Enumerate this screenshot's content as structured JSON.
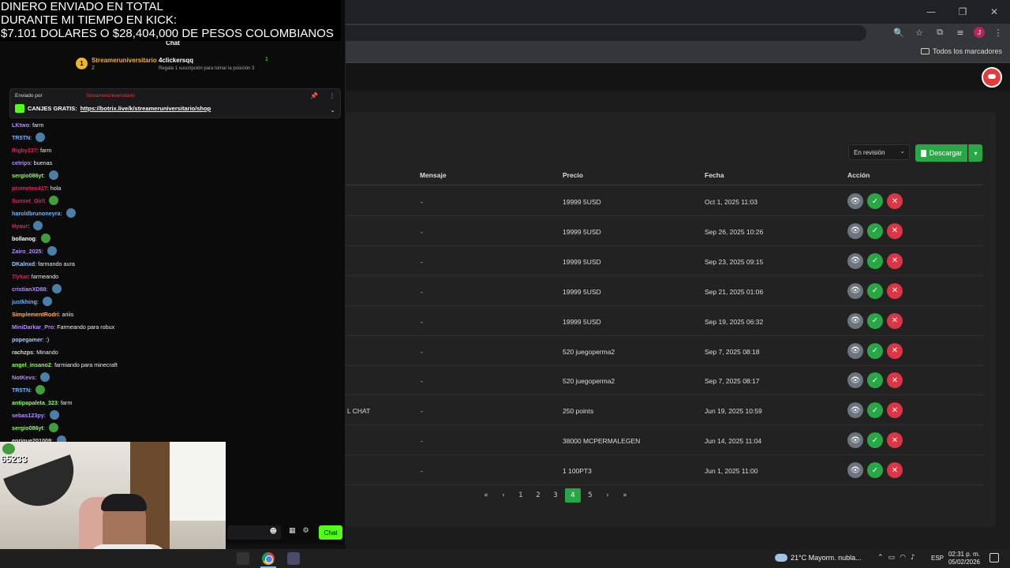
{
  "overlay": {
    "line1": "DINERO ENVIADO EN TOTAL",
    "line2": "DURANTE MI TIEMPO EN KICK:",
    "line3": "$7.101 DOLARES O $28,404,000 DE PESOS COLOMBIANOS"
  },
  "chat": {
    "title": "Chat",
    "top_gifters": [
      {
        "rank": "1",
        "name": "Streameruniversitario",
        "count": "2"
      },
      {
        "name": "4clickersqq",
        "count": "1",
        "subtext": "Regala 1 suscripción para tomar la posición 3"
      }
    ],
    "pinned": {
      "by_label": "Enviado por",
      "by_name": "Streameruniversitario",
      "message_prefix": "CANJES GRATIS:",
      "link": "https://botrix.live/k/streameruniversitario/shop"
    },
    "messages": [
      {
        "user": "LKtwo",
        "color": "#b18cff",
        "text": "farm",
        "emote": false
      },
      {
        "user": "TR5TN",
        "color": "#6fb4ff",
        "text": "",
        "emote": true
      },
      {
        "user": "Rigby237",
        "color": "#e0245e",
        "text": "farm",
        "emote": false
      },
      {
        "user": "cetrips",
        "color": "#b18cff",
        "text": "buenas",
        "emote": false
      },
      {
        "user": "sergio086yt",
        "color": "#8cff5a",
        "text": "",
        "emote": true
      },
      {
        "user": "prometeo417",
        "color": "#e0245e",
        "text": "hola",
        "emote": false
      },
      {
        "user": "Sunset_Girl",
        "color": "#e0245e",
        "text": "",
        "emote": true
      },
      {
        "user": "haroldbrunoneyra",
        "color": "#6fb4ff",
        "text": "",
        "emote": true
      },
      {
        "user": "Hyaur",
        "color": "#e0245e",
        "text": "",
        "emote": true
      },
      {
        "user": "bollanog",
        "color": "#ffffff",
        "text": "",
        "emote": true
      },
      {
        "user": "Zairo_2025",
        "color": "#b18cff",
        "text": "",
        "emote": true
      },
      {
        "user": "DKalnxd",
        "color": "#9ad0ff",
        "text": "farmando aura",
        "emote": false
      },
      {
        "user": "7lykar",
        "color": "#e0245e",
        "text": "farmeando",
        "emote": false
      },
      {
        "user": "cristianXD88",
        "color": "#b18cff",
        "text": "",
        "emote": true
      },
      {
        "user": "justkhing",
        "color": "#6fb4ff",
        "text": "",
        "emote": true
      },
      {
        "user": "SimplementRodri",
        "color": "#ffb14a",
        "text": "ariiis",
        "emote": false
      },
      {
        "user": "MiniDarkar_Pro",
        "color": "#b18cff",
        "text": "Farmeando para robux",
        "emote": false
      },
      {
        "user": "popegamer",
        "color": "#9ad0ff",
        "text": ":)",
        "emote": false
      },
      {
        "user": "rachzps",
        "color": "#dddddd",
        "text": "Minando",
        "emote": false
      },
      {
        "user": "angel_insano2",
        "color": "#8cff5a",
        "text": "farmiando para minecraft",
        "emote": false
      },
      {
        "user": "NotKevs",
        "color": "#b18cff",
        "text": "",
        "emote": true
      },
      {
        "user": "TR5TN",
        "color": "#6fb4ff",
        "text": "",
        "emote": true
      },
      {
        "user": "antipapaleta_323",
        "color": "#8cff5a",
        "text": "farm",
        "emote": false
      },
      {
        "user": "sebas123py",
        "color": "#b18cff",
        "text": "",
        "emote": true
      },
      {
        "user": "sergio086yt",
        "color": "#8cff5a",
        "text": "",
        "emote": true
      },
      {
        "user": "enrique201009",
        "color": "#dddddd",
        "text": "",
        "emote": true
      }
    ],
    "send_label": "Chat",
    "viewers": "65233"
  },
  "browser": {
    "bookmarks_folder": "Todos los marcadores",
    "profile_initial": "J"
  },
  "page": {
    "filter_value": "En revisión",
    "download_label": "Descargar",
    "columns": [
      "Mensaje",
      "Precio",
      "Fecha",
      "Acción"
    ],
    "rows": [
      {
        "truncated": "",
        "mensaje": "-",
        "precio": "19999 5USD",
        "fecha": "Oct 1, 2025 11:03"
      },
      {
        "truncated": "",
        "mensaje": "-",
        "precio": "19999 5USD",
        "fecha": "Sep 26, 2025 10:26"
      },
      {
        "truncated": "",
        "mensaje": "-",
        "precio": "19999 5USD",
        "fecha": "Sep 23, 2025 09:15"
      },
      {
        "truncated": "",
        "mensaje": "-",
        "precio": "19999 5USD",
        "fecha": "Sep 21, 2025 01:06"
      },
      {
        "truncated": "",
        "mensaje": "-",
        "precio": "19999 5USD",
        "fecha": "Sep 19, 2025 06:32"
      },
      {
        "truncated": "",
        "mensaje": "-",
        "precio": "520 juegoperma2",
        "fecha": "Sep 7, 2025 08:18"
      },
      {
        "truncated": "",
        "mensaje": "-",
        "precio": "520 juegoperma2",
        "fecha": "Sep 7, 2025 08:17"
      },
      {
        "truncated": "L CHAT",
        "mensaje": "-",
        "precio": "250 points",
        "fecha": "Jun 19, 2025 10:59"
      },
      {
        "truncated": "",
        "mensaje": "-",
        "precio": "38000 MCPERMALEGEN",
        "fecha": "Jun 14, 2025 11:04"
      },
      {
        "truncated": "",
        "mensaje": "-",
        "precio": "1 100PT3",
        "fecha": "Jun 1, 2025 11:00"
      }
    ],
    "pagination": {
      "first": "«",
      "prev": "‹",
      "pages": [
        "1",
        "2",
        "3",
        "4",
        "5"
      ],
      "current": "4",
      "next": "›",
      "last": "»"
    }
  },
  "taskbar": {
    "weather": "21°C  Mayorm. nubla...",
    "lang": "ESP",
    "time": "02:31 p. m.",
    "date": "05/02/2026"
  },
  "colors": {
    "accent_green": "#28a745",
    "kick_green": "#53fc18",
    "danger": "#dc3545",
    "muted": "#6c757d"
  }
}
